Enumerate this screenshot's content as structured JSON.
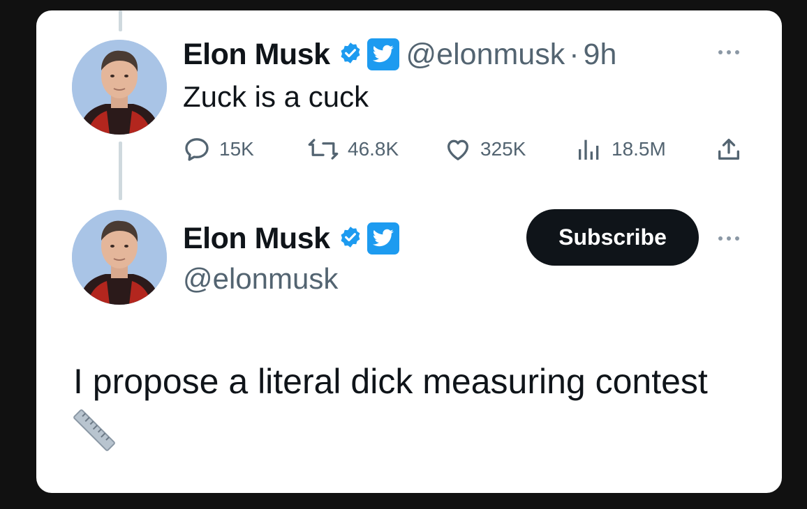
{
  "tweet1": {
    "author_name": "Elon Musk",
    "handle": "@elonmusk",
    "separator": "·",
    "time": "9h",
    "text": "Zuck is a cuck",
    "actions": {
      "replies": "15K",
      "retweets": "46.8K",
      "likes": "325K",
      "views": "18.5M"
    }
  },
  "tweet2": {
    "author_name": "Elon Musk",
    "handle": "@elonmusk",
    "subscribe_label": "Subscribe",
    "text": "I propose a literal dick measuring contest",
    "emoji": "straight-ruler-emoji"
  },
  "icons": {
    "verified": "verified-badge-icon",
    "twitter": "twitter-bird-icon",
    "reply": "reply-icon",
    "retweet": "retweet-icon",
    "like": "heart-icon",
    "views": "views-icon",
    "share": "share-icon",
    "more": "more-options-icon"
  },
  "colors": {
    "background": "#111111",
    "card": "#ffffff",
    "text": "#0f1419",
    "muted": "#536471",
    "accent": "#1d9bf0",
    "button": "#0f1419"
  }
}
